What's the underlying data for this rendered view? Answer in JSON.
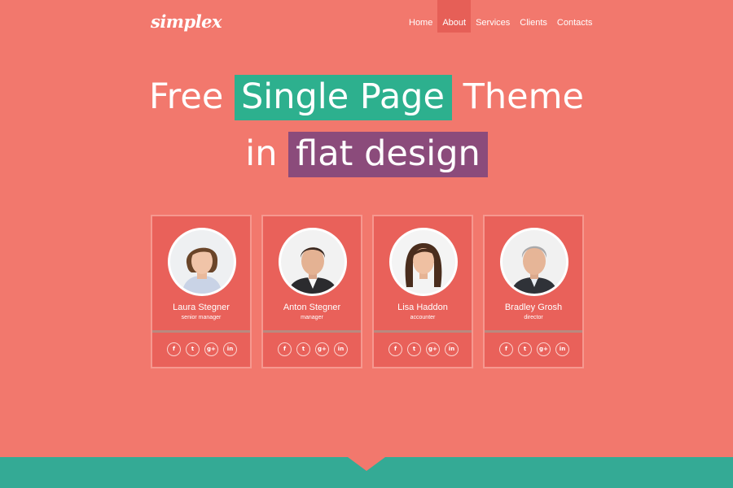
{
  "header": {
    "logo": "simplex",
    "nav": [
      {
        "label": "Home",
        "active": false
      },
      {
        "label": "About",
        "active": true
      },
      {
        "label": "Services",
        "active": false
      },
      {
        "label": "Clients",
        "active": false
      },
      {
        "label": "Contacts",
        "active": false
      }
    ]
  },
  "hero": {
    "line1_pre": "Free ",
    "line1_highlight": "Single Page",
    "line1_post": " Theme",
    "line2_pre": "in ",
    "line2_highlight": "flat design"
  },
  "team": [
    {
      "name": "Laura Stegner",
      "role": "senior manager",
      "avatar": "woman-short-hair"
    },
    {
      "name": "Anton Stegner",
      "role": "manager",
      "avatar": "man-suit"
    },
    {
      "name": "Lisa Haddon",
      "role": "accounter",
      "avatar": "woman-long-hair"
    },
    {
      "name": "Bradley Grosh",
      "role": "director",
      "avatar": "man-gray-hair"
    }
  ],
  "socials": [
    {
      "name": "facebook-icon",
      "glyph": "f"
    },
    {
      "name": "twitter-icon",
      "glyph": "t"
    },
    {
      "name": "google-plus-icon",
      "glyph": "g+"
    },
    {
      "name": "linkedin-icon",
      "glyph": "in"
    }
  ],
  "colors": {
    "background": "#f2786d",
    "card": "#e9615a",
    "highlight_green": "#2db08e",
    "highlight_purple": "#8b4b7b",
    "footer": "#34aa95",
    "nav_active": "#e65f57"
  }
}
